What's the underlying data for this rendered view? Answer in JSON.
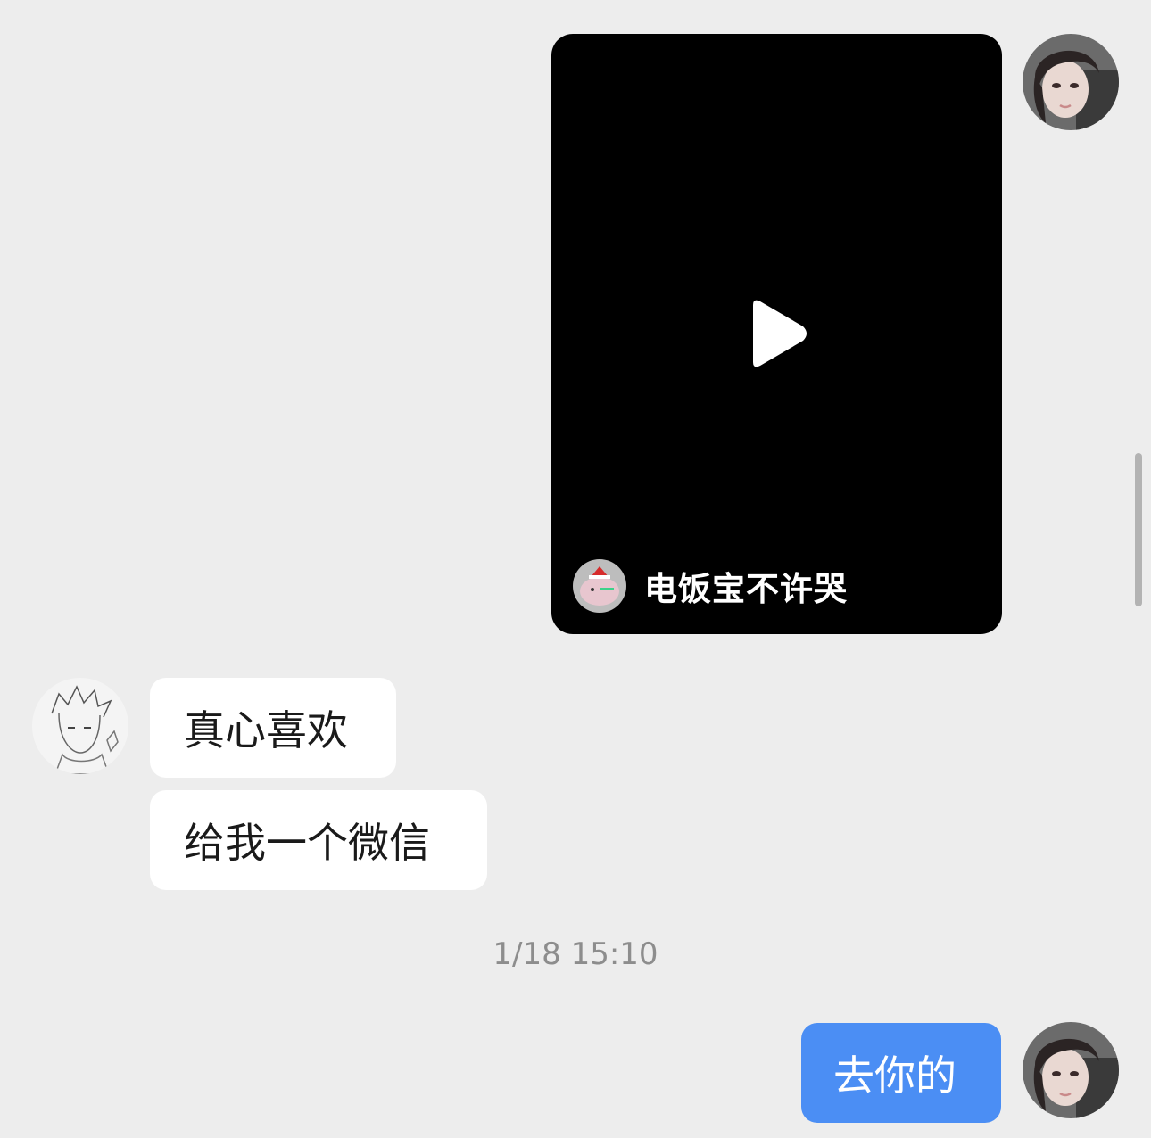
{
  "video_message": {
    "author_name": "电饭宝不许哭",
    "play_icon": "play-icon"
  },
  "messages": {
    "peer_1": "真心喜欢",
    "peer_2": "给我一个微信",
    "self_1": "去你的"
  },
  "timestamp": "1/18 15:10",
  "colors": {
    "background": "#ededed",
    "self_bubble": "#4b8ef4",
    "peer_bubble": "#ffffff",
    "video_background": "#000000"
  },
  "icons": {
    "self_avatar": "avatar-photo-girl",
    "peer_avatar": "avatar-sketch-anime",
    "author_avatar": "avatar-piggy-bank"
  }
}
